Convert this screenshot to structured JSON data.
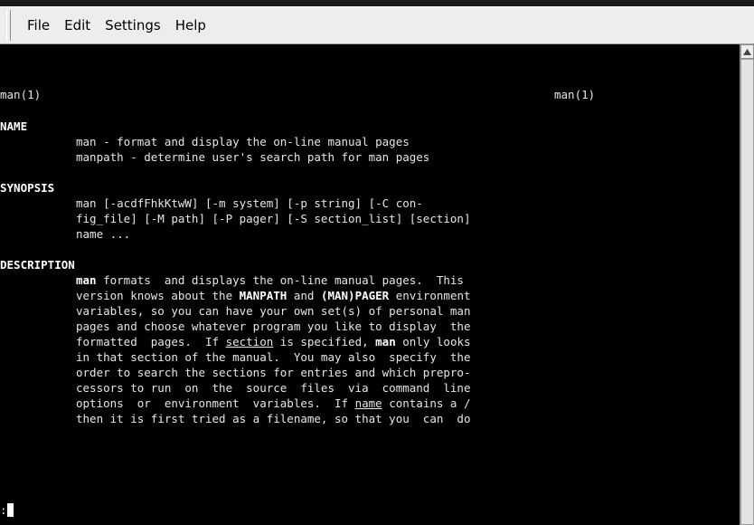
{
  "menubar": {
    "items": [
      "File",
      "Edit",
      "Settings",
      "Help"
    ]
  },
  "terminal": {
    "header_left": "man(1)",
    "header_right": "man(1)",
    "name_heading": "NAME",
    "name_lines": [
      "man - format and display the on-line manual pages",
      "manpath - determine user's search path for man pages"
    ],
    "synopsis_heading": "SYNOPSIS",
    "synopsis_lines": [
      "man [-acdfFhkKtwW] [-m system] [-p string] [-C con-",
      "fig_file] [-M path] [-P pager] [-S section_list] [section]",
      "name ..."
    ],
    "description_heading": "DESCRIPTION",
    "desc": {
      "l1_a": "man",
      "l1_b": " formats  and displays the on-line manual pages.  This",
      "l2_a": "version knows about the ",
      "l2_b": "MANPATH",
      "l2_c": " and ",
      "l2_d": "(MAN)PAGER",
      "l2_e": " environment",
      "l3": "variables, so you can have your own set(s) of personal man",
      "l4": "pages and choose whatever program you like to display  the",
      "l5_a": "formatted  pages.  If ",
      "l5_b": "section",
      "l5_c": " is specified, ",
      "l5_d": "man",
      "l5_e": " only looks",
      "l6": "in that section of the manual.  You may also  specify  the",
      "l7": "order to search the sections for entries and which prepro-",
      "l8": "cessors to run  on  the  source  files  via  command  line",
      "l9_a": "options  or  environment  variables.  If ",
      "l9_b": "name",
      "l9_c": " contains a /",
      "l10": "then it is first tried as a filename, so that you  can  do"
    },
    "prompt": ":"
  }
}
